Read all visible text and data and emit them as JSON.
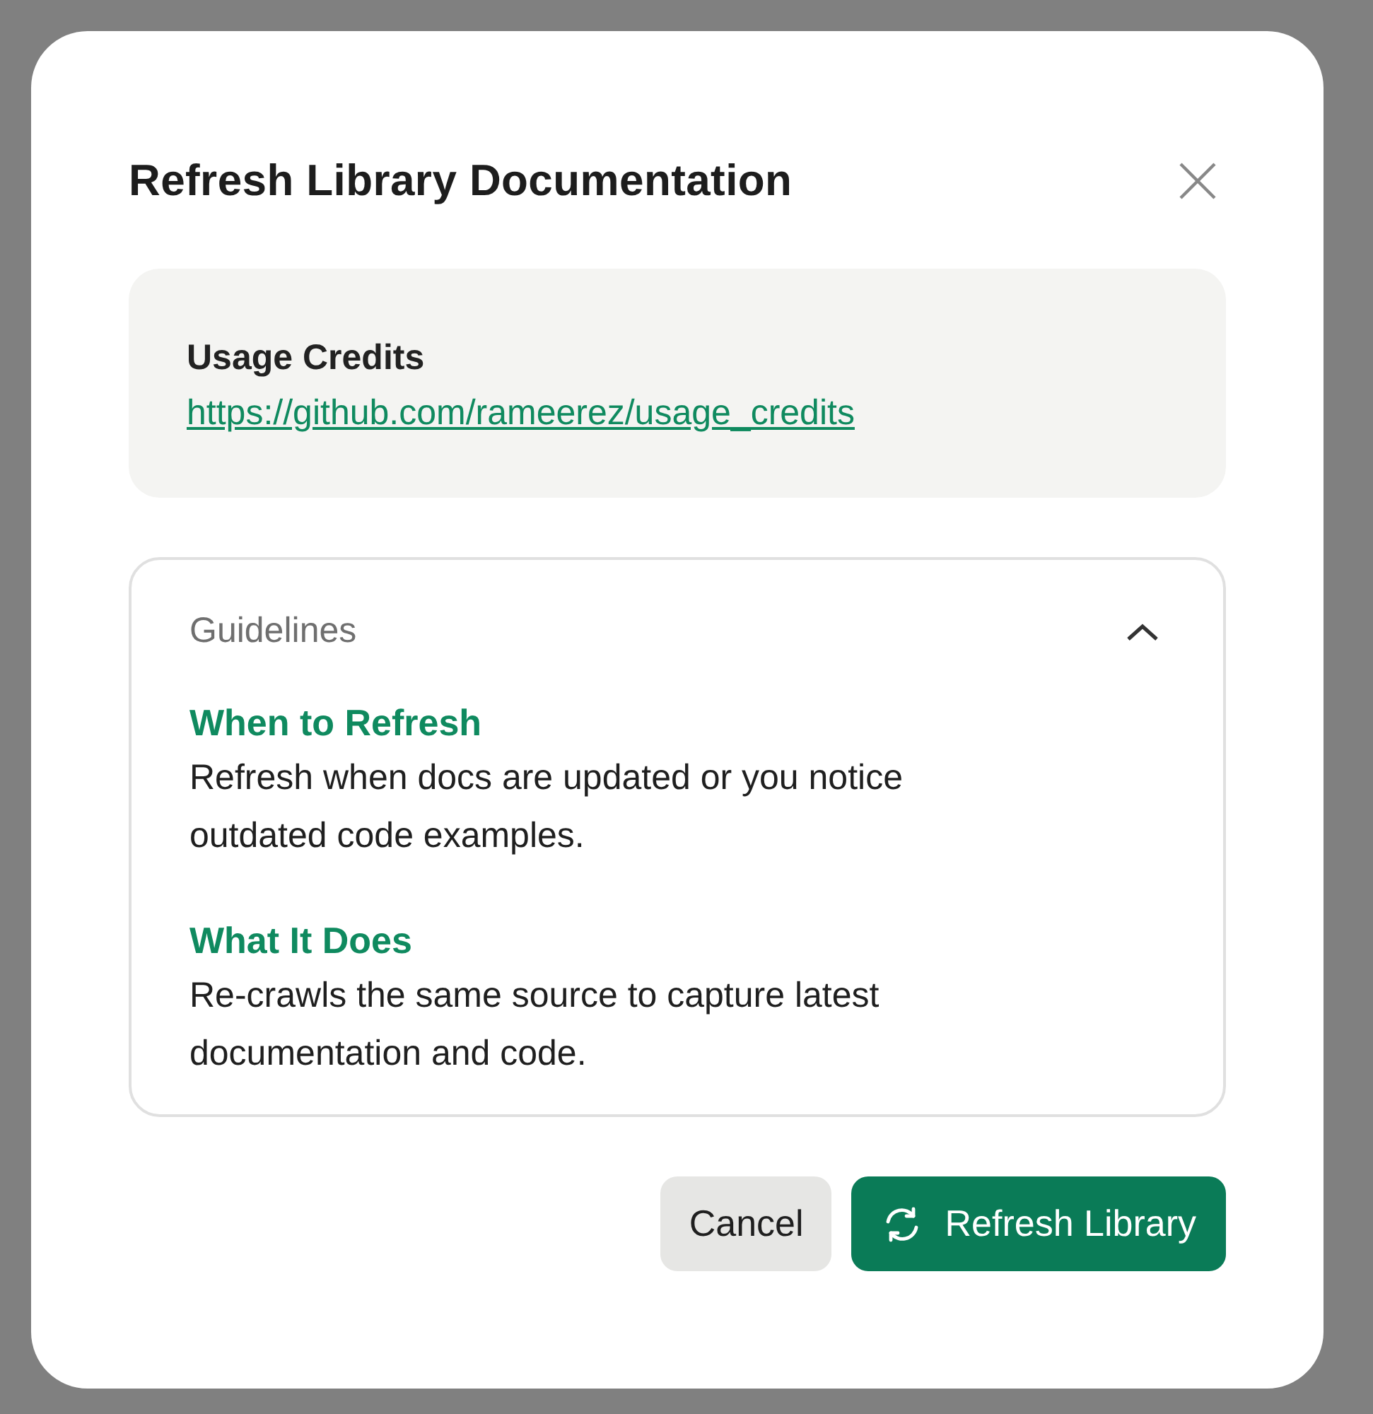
{
  "dialog": {
    "title": "Refresh Library Documentation",
    "source": {
      "name": "Usage Credits",
      "url": "https://github.com/rameerez/usage_credits"
    },
    "guidelines": {
      "title": "Guidelines",
      "expanded": true,
      "items": [
        {
          "heading": "When to Refresh",
          "text": "Refresh when docs are updated or you notice outdated code examples."
        },
        {
          "heading": "What It Does",
          "text": "Re-crawls the same source to capture latest documentation and code."
        }
      ]
    },
    "buttons": [
      {
        "kind": "secondary",
        "label": "Cancel"
      },
      {
        "kind": "primary",
        "label": "Refresh Library"
      }
    ]
  }
}
